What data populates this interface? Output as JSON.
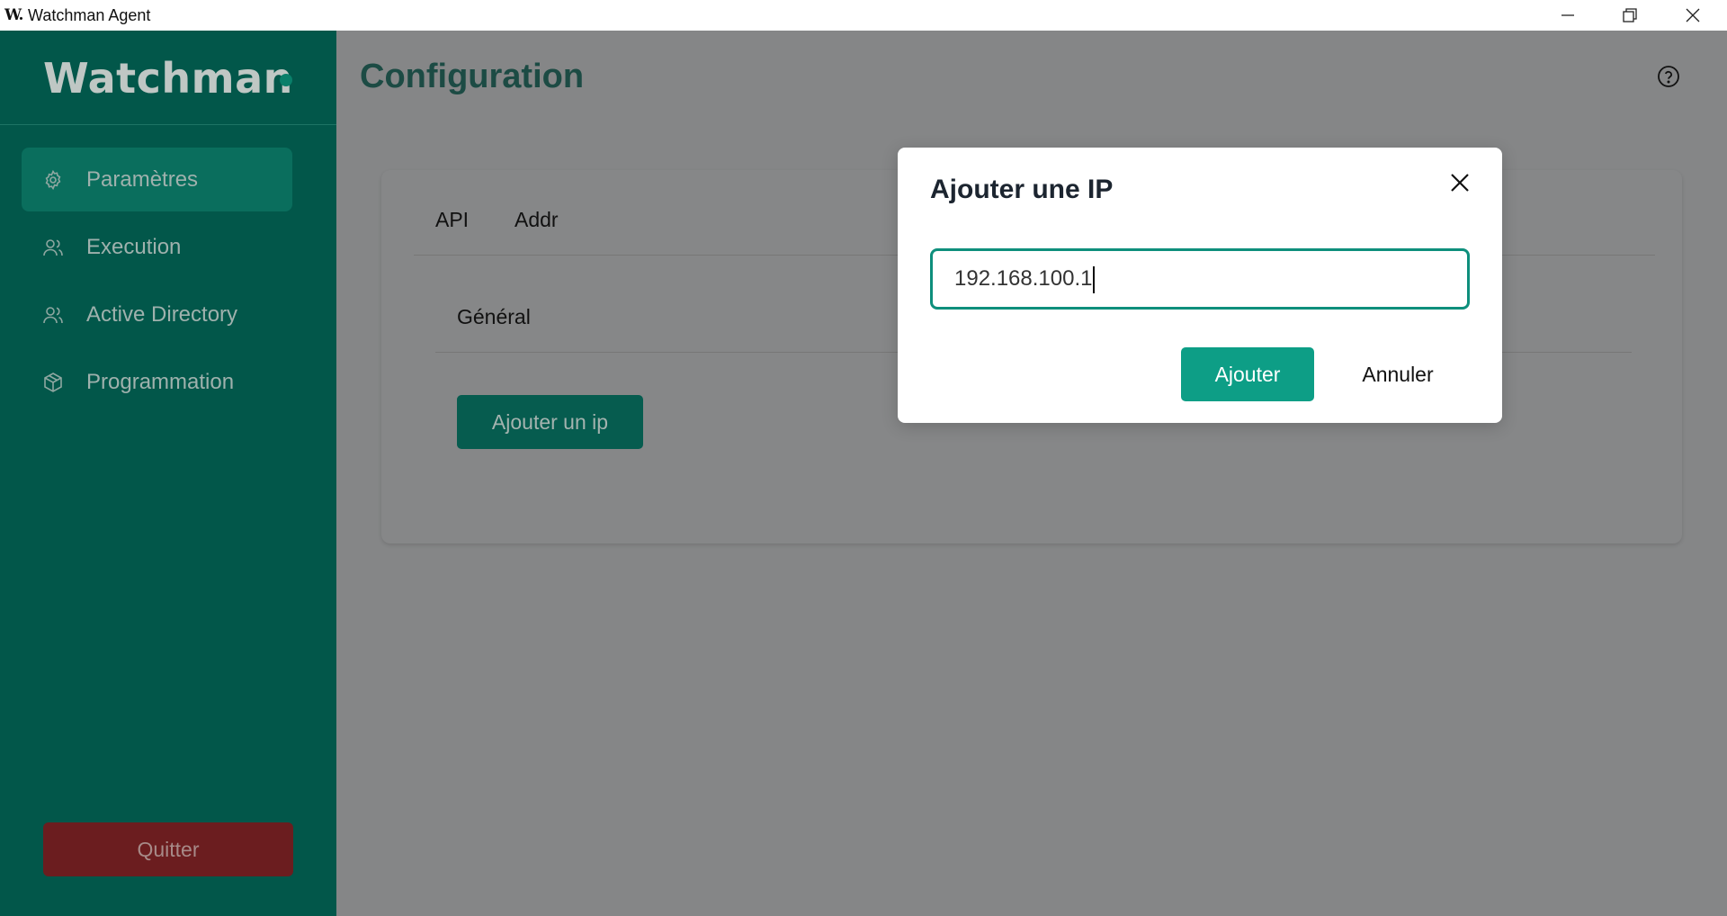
{
  "window": {
    "app_icon_text": "W.",
    "title": "Watchman Agent"
  },
  "sidebar": {
    "logo": "Watchman",
    "items": [
      {
        "label": "Paramètres",
        "icon": "gear-icon",
        "active": true
      },
      {
        "label": "Execution",
        "icon": "users-icon",
        "active": false
      },
      {
        "label": "Active Directory",
        "icon": "users-icon",
        "active": false
      },
      {
        "label": "Programmation",
        "icon": "cube-icon",
        "active": false
      }
    ],
    "quit_label": "Quitter"
  },
  "main": {
    "title": "Configuration",
    "tabs": [
      {
        "label": "API"
      },
      {
        "label": "Addr"
      }
    ],
    "subtabs": [
      {
        "label": "Général"
      }
    ],
    "add_ip_label": "Ajouter un ip"
  },
  "modal": {
    "title": "Ajouter une IP",
    "input_value": "192.168.100.1",
    "confirm_label": "Ajouter",
    "cancel_label": "Annuler"
  },
  "colors": {
    "sidebar_bg": "#02574a",
    "accent": "#0d9e86",
    "quit_bg": "#6b1d1f",
    "overlay_bg": "#858687"
  }
}
